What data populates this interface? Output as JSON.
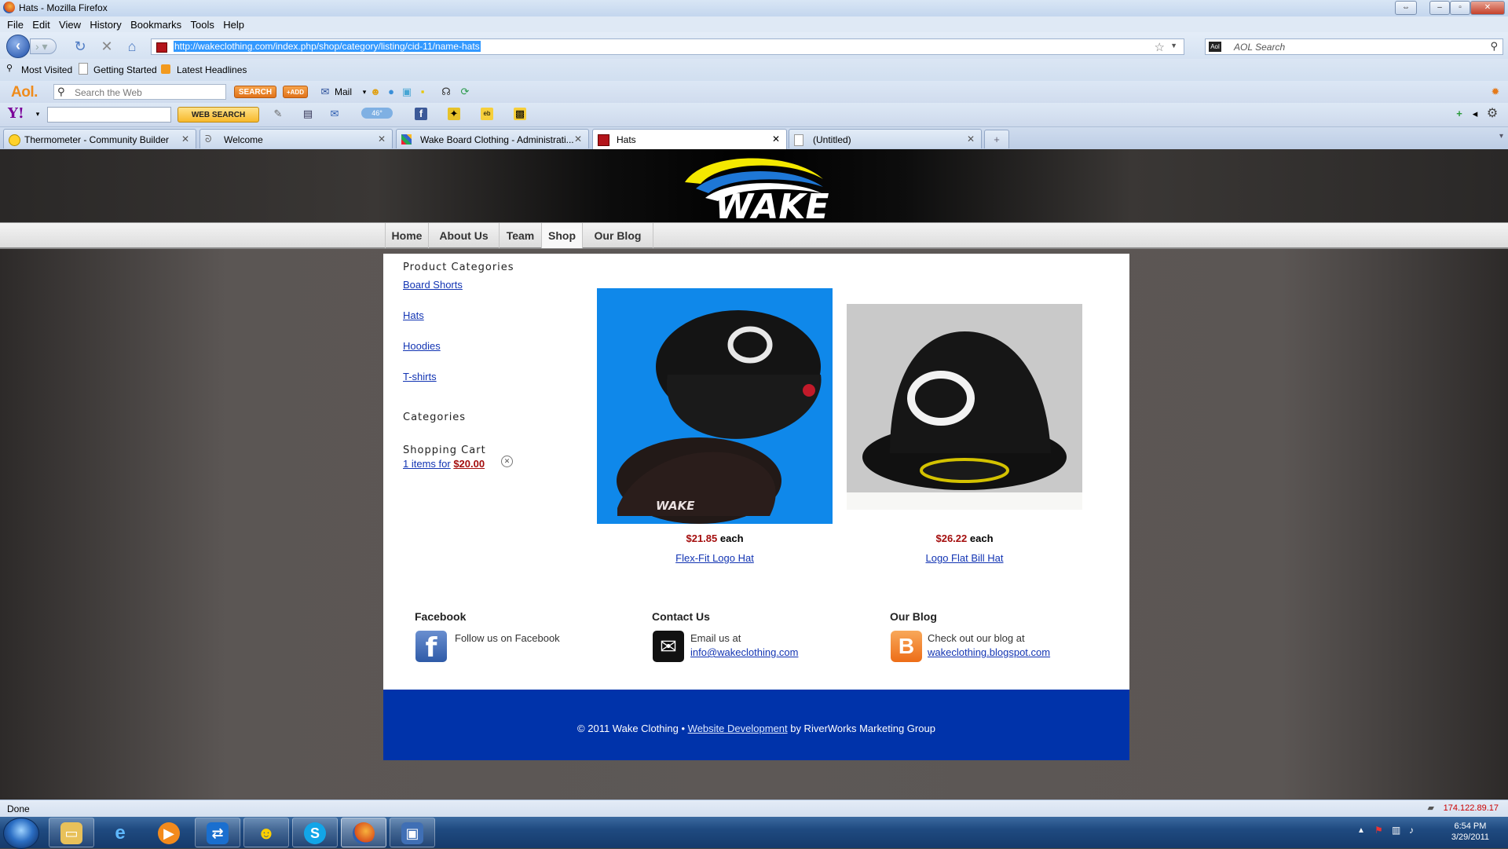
{
  "window": {
    "title": "Hats - Mozilla Firefox"
  },
  "menu": [
    "File",
    "Edit",
    "View",
    "History",
    "Bookmarks",
    "Tools",
    "Help"
  ],
  "address": {
    "url": "http://wakeclothing.com/index.php/shop/category/listing/cid-11/name-hats"
  },
  "search": {
    "placeholder": "AOL Search"
  },
  "bookmarks": [
    "Most Visited",
    "Getting Started",
    "Latest Headlines"
  ],
  "aol": {
    "logo": "Aol.",
    "placeholder": "Search the Web",
    "search_label": "SEARCH",
    "add_label": "+ADD",
    "mail_label": "Mail"
  },
  "yahoo": {
    "logo": "Y!",
    "websearch_label": "WEB SEARCH",
    "weather_badge": "46°"
  },
  "tabs": [
    {
      "label": "Thermometer - Community Builder"
    },
    {
      "label": "Welcome"
    },
    {
      "label": "Wake Board Clothing - Administrati..."
    },
    {
      "label": "Hats"
    },
    {
      "label": "(Untitled)"
    }
  ],
  "site": {
    "logo_text": "WAKE",
    "nav": [
      "Home",
      "About Us",
      "Team",
      "Shop",
      "Our Blog"
    ],
    "product_categories_heading": "Product Categories",
    "categories": [
      "Board Shorts",
      "Hats",
      "Hoodies",
      "T-shirts"
    ],
    "categories_heading": "Categories",
    "cart_heading": "Shopping Cart",
    "cart_items": "1 items for",
    "cart_total": "$20.00",
    "products": [
      {
        "price": "$21.85",
        "unit": "each",
        "name": "Flex-Fit Logo Hat"
      },
      {
        "price": "$26.22",
        "unit": "each",
        "name": "Logo Flat Bill Hat"
      }
    ],
    "footer": {
      "facebook": {
        "heading": "Facebook",
        "text": "Follow us on Facebook"
      },
      "contact": {
        "heading": "Contact Us",
        "text": "Email us at",
        "link": "info@wakeclothing.com"
      },
      "blog": {
        "heading": "Our Blog",
        "text": "Check out our blog at",
        "link": "wakeclothing.blogspot.com"
      }
    },
    "copyright": {
      "prefix": "© 2011 Wake Clothing •",
      "link": "Website Development",
      "suffix": "by RiverWorks Marketing Group"
    }
  },
  "status": {
    "text": "Done",
    "ip": "174.122.89.17"
  },
  "clock": {
    "time": "6:54 PM",
    "date": "3/29/2011"
  },
  "colors": {
    "footer_blue": "#0033aa",
    "price_red": "#a40d0d",
    "link_blue": "#1234b3"
  }
}
